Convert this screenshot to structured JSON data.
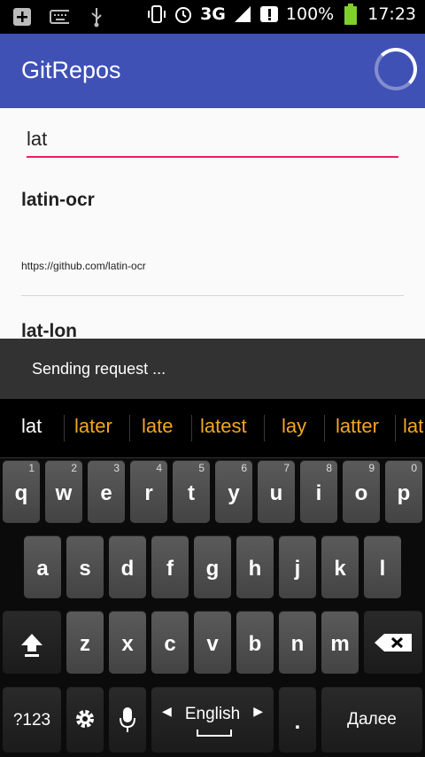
{
  "status_bar": {
    "signal": "3G",
    "battery": "100%",
    "time": "17:23",
    "icons": [
      "add-box-icon",
      "keyboard-icon",
      "usb-icon",
      "vibrate-icon",
      "alarm-icon",
      "signal-icon",
      "alert-icon",
      "battery-icon"
    ]
  },
  "app": {
    "title": "GitRepos"
  },
  "search": {
    "value": "lat"
  },
  "results": [
    {
      "name": "latin-ocr",
      "url": "https://github.com/latin-ocr"
    },
    {
      "name": "lat-lon",
      "url": ""
    }
  ],
  "snackbar": {
    "text": "Sending request ..."
  },
  "suggestions": {
    "typed": "lat",
    "words": [
      "later",
      "late",
      "latest",
      "lay",
      "latter",
      "lat"
    ]
  },
  "keyboard": {
    "row1": [
      {
        "l": "q",
        "h": "1"
      },
      {
        "l": "w",
        "h": "2"
      },
      {
        "l": "e",
        "h": "3"
      },
      {
        "l": "r",
        "h": "4"
      },
      {
        "l": "t",
        "h": "5"
      },
      {
        "l": "y",
        "h": "6"
      },
      {
        "l": "u",
        "h": "7"
      },
      {
        "l": "i",
        "h": "8"
      },
      {
        "l": "o",
        "h": "9"
      },
      {
        "l": "p",
        "h": "0"
      }
    ],
    "row2": [
      "a",
      "s",
      "d",
      "f",
      "g",
      "h",
      "j",
      "k",
      "l"
    ],
    "row3": [
      "z",
      "x",
      "c",
      "v",
      "b",
      "n",
      "m"
    ],
    "numbers_label": "?123",
    "language_label": "English",
    "period_label": ".",
    "enter_label": "Далее"
  },
  "colors": {
    "appbar": "#3f51b5",
    "accent": "#e91e63",
    "suggestion": "#f5a623"
  }
}
